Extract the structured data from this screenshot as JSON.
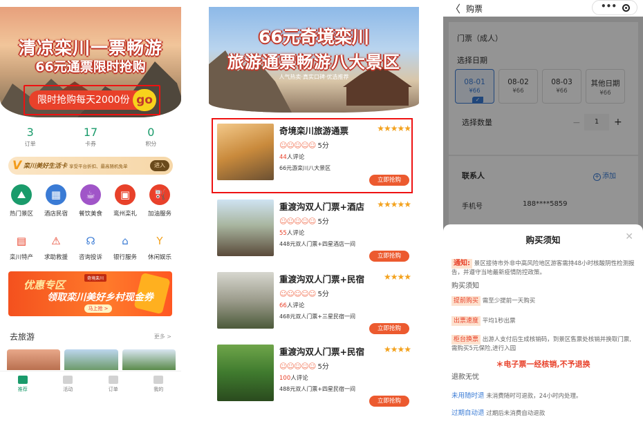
{
  "colors": {
    "accent_green": "#1a9b6b",
    "accent_red": "#e8412a",
    "accent_blue": "#3a7bd5",
    "star": "#f3a21e"
  },
  "screen1": {
    "banner": {
      "title1": "清凉栾川一票畅游",
      "title2": "66元通票限时抢购",
      "cta": "限时抢购每天2000份",
      "cta_go": "go"
    },
    "stats": [
      {
        "num": "3",
        "label": "订单"
      },
      {
        "num": "17",
        "label": "卡券"
      },
      {
        "num": "0",
        "label": "积分"
      }
    ],
    "member": {
      "logo": "V",
      "title": "栾川美好生活卡",
      "desc": "享受平台折扣、最高随机免单",
      "button": "进入"
    },
    "grid_row1": [
      {
        "icon": "mountain-icon",
        "glyph": "⛰",
        "color": "#1a9b6b",
        "label": "热门景区"
      },
      {
        "icon": "hotel-icon",
        "glyph": "▦",
        "color": "#3a7bd5",
        "label": "酒店民宿"
      },
      {
        "icon": "dining-icon",
        "glyph": "☕",
        "color": "#a055c8",
        "label": "餐饮美食"
      },
      {
        "icon": "gift-icon",
        "glyph": "▣",
        "color": "#e8412a",
        "label": "鸾州栾礼"
      },
      {
        "icon": "fuel-icon",
        "glyph": "⛽",
        "color": "#e8412a",
        "label": "加油服务"
      }
    ],
    "grid_row2": [
      {
        "icon": "specialty-icon",
        "glyph": "▤",
        "color": "#e8412a",
        "label": "栾川特产"
      },
      {
        "icon": "rescue-icon",
        "glyph": "⚠",
        "color": "#e8412a",
        "label": "求助救援"
      },
      {
        "icon": "headset-icon",
        "glyph": "☊",
        "color": "#3a7bd5",
        "label": "咨询投诉"
      },
      {
        "icon": "bank-icon",
        "glyph": "⌂",
        "color": "#3a7bd5",
        "label": "银行服务"
      },
      {
        "icon": "cocktail-icon",
        "glyph": "Y",
        "color": "#f3a21e",
        "label": "休闲娱乐"
      }
    ],
    "promo": {
      "top": "优惠专区",
      "tag": "奇境栾川",
      "main": "领取栾川美好乡村现金券",
      "button": "马上抢 >"
    },
    "section_title": "去旅游",
    "more": "更多 >",
    "tabs": [
      {
        "icon": "thumb-up-icon",
        "label": "推荐",
        "active": true
      },
      {
        "icon": "calendar-icon",
        "label": "活动",
        "active": false
      },
      {
        "icon": "order-icon",
        "label": "订单",
        "active": false
      },
      {
        "icon": "user-icon",
        "label": "我的",
        "active": false
      }
    ]
  },
  "screen2": {
    "banner": {
      "title1": "66元奇境栾川",
      "title2": "旅游通票畅游八大景区",
      "sub": "人气热卖·真实口碑·优选推荐"
    },
    "items": [
      {
        "name": "奇境栾川旅游通票",
        "stars": "★★★★★",
        "score": "5分",
        "comments_num": "44",
        "comments_text": "人评论",
        "desc": "66元游栾川八大景区",
        "buy": "立即抢购",
        "thumb": "linear-gradient(160deg,#f3c98a,#c98a3c 50%,#6b5032)"
      },
      {
        "name": "重渡沟双人门票+酒店",
        "stars": "★★★★★",
        "score": "5分",
        "comments_num": "55",
        "comments_text": "人评论",
        "desc": "448元双人门票+四星酒店一间",
        "buy": "立即抢购",
        "thumb": "linear-gradient(180deg,#cfe3f2,#a9b6a0 45%,#5a4a3a)"
      },
      {
        "name": "重渡沟双人门票+民宿",
        "stars": "★★★★",
        "score": "5分",
        "comments_num": "66",
        "comments_text": "人评论",
        "desc": "468元双人门票+三星民宿一间",
        "buy": "立即抢购",
        "thumb": "linear-gradient(180deg,#d7d7cf,#9c9c8c 50%,#4c5a3a)"
      },
      {
        "name": "重渡沟双人门票+民宿",
        "stars": "★★★★",
        "score": "5分",
        "comments_num": "100",
        "comments_text": "人评论",
        "desc": "488元双人门票+四星民宿一间",
        "buy": "立即抢购",
        "thumb": "linear-gradient(180deg,#6fa54a,#3f7a2e 50%,#2a4a1e)"
      }
    ],
    "score_dots": "☺☺☺☺☺"
  },
  "screen3": {
    "nav": {
      "back": "〈",
      "title": "购票",
      "more": "•••"
    },
    "ticket_type": "门票（成人）",
    "choose_date": "选择日期",
    "dates": [
      {
        "date": "08-01",
        "price": "¥66",
        "selected": true
      },
      {
        "date": "08-02",
        "price": "¥66",
        "selected": false
      },
      {
        "date": "08-03",
        "price": "¥66",
        "selected": false
      },
      {
        "date": "其他日期",
        "price": "¥66",
        "selected": false
      }
    ],
    "choose_qty": "选择数量",
    "qty_minus": "−",
    "qty_value": "1",
    "qty_plus": "+",
    "contact": "联系人",
    "add": "添加",
    "add_icon": "+",
    "phone_label": "手机号",
    "phone_value": "188****5859",
    "sheet": {
      "title": "购买须知",
      "close": "✕",
      "notice_tag": "通知:",
      "notice_text": "景区接待市外非中高风险地区游客需持48小时核酸阴性检测报告，并遵守当地最新疫情防控政策。",
      "section1": "购买须知",
      "rows": [
        {
          "tag": "提前购买",
          "text": "需至少提前一天购买"
        },
        {
          "tag": "出票速度",
          "text": "平均1秒出票"
        },
        {
          "tag": "柜台换票",
          "text": "出游人支付后生成核销码，到景区售票处核销并换取门票,需购买5元保险,进行入园"
        }
      ],
      "warning": "＊电子票一经核销,不予退换",
      "section2": "退款无忧",
      "refund_rows": [
        {
          "tag": "未用随时退",
          "text": "未消费随时可退款，24小时内处理。"
        },
        {
          "tag": "过期自动退",
          "text": "过期后未消费自动退款"
        }
      ]
    }
  }
}
